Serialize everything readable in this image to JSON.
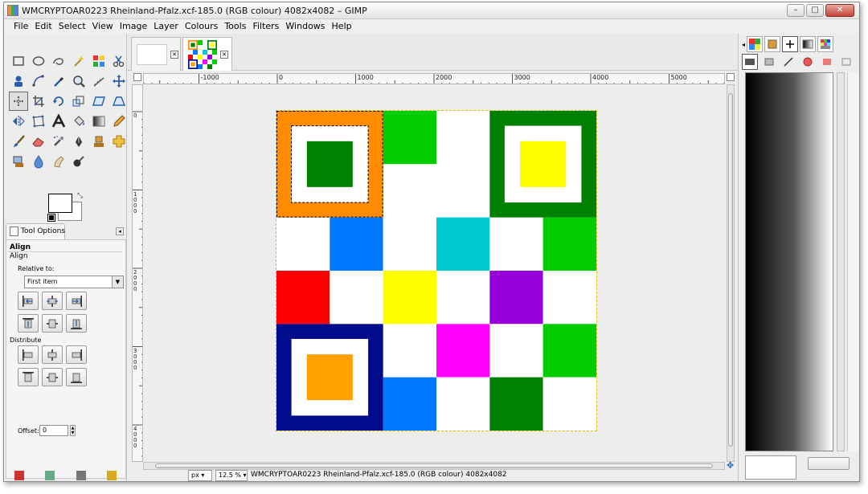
{
  "window": {
    "title": "WMCRYPTOAR0223 Rheinland-Pfalz.xcf-185.0 (RGB colour) 4082x4082 – GIMP",
    "controls": {
      "minimize": "–",
      "maximize": "□",
      "close": "✕"
    }
  },
  "menubar": {
    "items": [
      {
        "label": "File"
      },
      {
        "label": "Edit"
      },
      {
        "label": "Select"
      },
      {
        "label": "View"
      },
      {
        "label": "Image"
      },
      {
        "label": "Layer"
      },
      {
        "label": "Colours"
      },
      {
        "label": "Tools"
      },
      {
        "label": "Filters"
      },
      {
        "label": "Windows"
      },
      {
        "label": "Help"
      }
    ]
  },
  "toolbox": {
    "tools": [
      "rect-select-icon",
      "ellipse-select-icon",
      "free-select-icon",
      "fuzzy-select-icon",
      "select-by-color-icon",
      "scissors-icon",
      "foreground-select-icon",
      "paths-icon",
      "color-picker-icon",
      "zoom-icon",
      "measure-icon",
      "move-icon",
      "align-icon",
      "crop-icon",
      "rotate-icon",
      "scale-icon",
      "shear-icon",
      "perspective-icon",
      "flip-icon",
      "cage-icon",
      "text-icon",
      "bucket-fill-icon",
      "blend-icon",
      "pencil-icon",
      "paintbrush-icon",
      "eraser-icon",
      "airbrush-icon",
      "ink-icon",
      "clone-icon",
      "heal-icon",
      "perspective-clone-icon",
      "blur-icon",
      "smudge-icon",
      "dodge-burn-icon"
    ],
    "active_tool": "align-icon",
    "foreground_color": "#ffffff",
    "background_color": "#ffffff"
  },
  "tool_options": {
    "tab_label": "Tool Options",
    "heading": "Align",
    "subheading": "Align",
    "relative_to_label": "Relative to:",
    "relative_to_value": "First item",
    "distribute_label": "Distribute",
    "offset_label": "Offset:",
    "offset_value": "0"
  },
  "image_tabs": [
    {
      "name": "blank-image",
      "active": false
    },
    {
      "name": "Rheinland-Pfalz",
      "active": true
    }
  ],
  "rulers": {
    "horizontal_labels": [
      "-1000",
      "0",
      "1000",
      "2000",
      "3000",
      "4000",
      "5000"
    ],
    "vertical_labels": [
      "0",
      "1000",
      "2000",
      "3000",
      "4000"
    ]
  },
  "canvas": {
    "grid_size": 6,
    "cells": [
      {
        "row": 0,
        "col": 2,
        "color": "#00cc00"
      },
      {
        "row": 1,
        "col": 2,
        "color": "#ffffff"
      },
      {
        "row": 1,
        "col": 1,
        "color": "#ffff00"
      },
      {
        "row": 2,
        "col": 0,
        "color": "#ffffff"
      },
      {
        "row": 2,
        "col": 1,
        "color": "#0078ff"
      },
      {
        "row": 2,
        "col": 2,
        "color": "#ffffff"
      },
      {
        "row": 2,
        "col": 3,
        "color": "#00ccd0"
      },
      {
        "row": 2,
        "col": 4,
        "color": "#ffffff"
      },
      {
        "row": 2,
        "col": 5,
        "color": "#00cc00"
      },
      {
        "row": 3,
        "col": 0,
        "color": "#ff0000"
      },
      {
        "row": 3,
        "col": 1,
        "color": "#ffffff"
      },
      {
        "row": 3,
        "col": 2,
        "color": "#ffff00"
      },
      {
        "row": 3,
        "col": 3,
        "color": "#ffffff"
      },
      {
        "row": 3,
        "col": 4,
        "color": "#9600d8"
      },
      {
        "row": 3,
        "col": 5,
        "color": "#ffffff"
      },
      {
        "row": 4,
        "col": 2,
        "color": "#ffffff"
      },
      {
        "row": 4,
        "col": 3,
        "color": "#ff00ff"
      },
      {
        "row": 4,
        "col": 4,
        "color": "#ffffff"
      },
      {
        "row": 4,
        "col": 5,
        "color": "#00cc00"
      },
      {
        "row": 5,
        "col": 2,
        "color": "#0078ff"
      },
      {
        "row": 5,
        "col": 3,
        "color": "#ffffff"
      },
      {
        "row": 5,
        "col": 4,
        "color": "#008000"
      },
      {
        "row": 5,
        "col": 5,
        "color": "#ffffff"
      }
    ],
    "finders": [
      {
        "row": 0,
        "col": 0,
        "outer": "#ff8c00",
        "inner": "#008000"
      },
      {
        "row": 0,
        "col": 4,
        "outer": "#008000",
        "inner": "#ffff00"
      },
      {
        "row": 4,
        "col": 0,
        "outer": "#000c8c",
        "inner": "#ffa000"
      }
    ]
  },
  "statusbar": {
    "unit": "px",
    "zoom": "12.5 %",
    "text": "WMCRYPTOAR0223 Rheinland-Pfalz.xcf-185.0 (RGB colour) 4082x4082"
  },
  "dock": {
    "top_icons": [
      "patterns-icon",
      "brushes-icon",
      "fonts-icon",
      "gradients-icon",
      "palettes-icon"
    ],
    "second_icons": [
      "layers-icon",
      "channels-icon",
      "paths-icon",
      "colormap-icon",
      "histogram-icon",
      "undo-icon"
    ]
  }
}
